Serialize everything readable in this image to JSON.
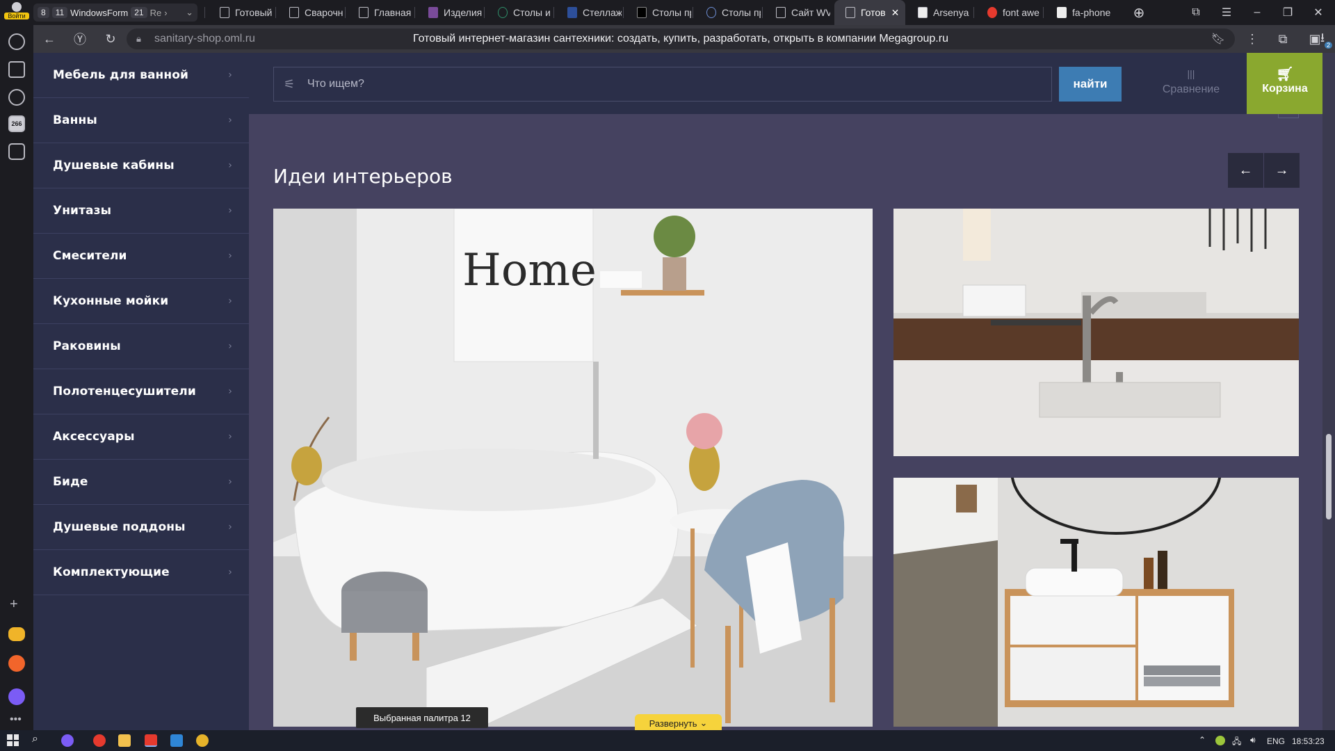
{
  "browser": {
    "tab_group": {
      "count_a": "8",
      "count_b": "11",
      "label": "WindowsForm",
      "count_c": "21",
      "more": "Re"
    },
    "tabs": [
      {
        "label": "Готовый"
      },
      {
        "label": "Сварочн"
      },
      {
        "label": "Главная"
      },
      {
        "label": "Изделия"
      },
      {
        "label": "Столы и"
      },
      {
        "label": "Стеллаж"
      },
      {
        "label": "Столы пр"
      },
      {
        "label": "Столы пр"
      },
      {
        "label": "Сайт WV"
      },
      {
        "label": "Готов"
      },
      {
        "label": "Arsenya"
      },
      {
        "label": "font awe"
      },
      {
        "label": "fa-phone"
      }
    ],
    "profile_label": "Войти",
    "url": "sanitary-shop.oml.ru",
    "page_title": "Готовый интернет-магазин сантехники: создать, купить, разработать, открыть в компании Megagroup.ru",
    "sidebar_badge": "266",
    "downloads_badge": "2"
  },
  "site": {
    "categories": [
      {
        "label": "Мебель для ванной"
      },
      {
        "label": "Ванны"
      },
      {
        "label": "Душевые кабины"
      },
      {
        "label": "Унитазы"
      },
      {
        "label": "Смесители"
      },
      {
        "label": "Кухонные мойки"
      },
      {
        "label": "Раковины"
      },
      {
        "label": "Полотенцесушители"
      },
      {
        "label": "Аксессуары"
      },
      {
        "label": "Биде"
      },
      {
        "label": "Душевые поддоны"
      },
      {
        "label": "Комплектующие"
      }
    ],
    "search": {
      "placeholder": "Что ищем?",
      "button": "найти"
    },
    "compare_label": "Сравнение",
    "cart_label": "Корзина",
    "section_title": "Идеи интерьеров",
    "photo_text": "Home"
  },
  "overlays": {
    "palette_label": "Выбранная палитра 12",
    "expand_label": "Развернуть"
  },
  "taskbar": {
    "lang": "ENG",
    "time": "18:53:23"
  },
  "colors": {
    "accent_blue": "#3d7cb3",
    "cart_green": "#8aa82f",
    "menu_bg": "#2b2f49",
    "page_bg": "#454260"
  }
}
